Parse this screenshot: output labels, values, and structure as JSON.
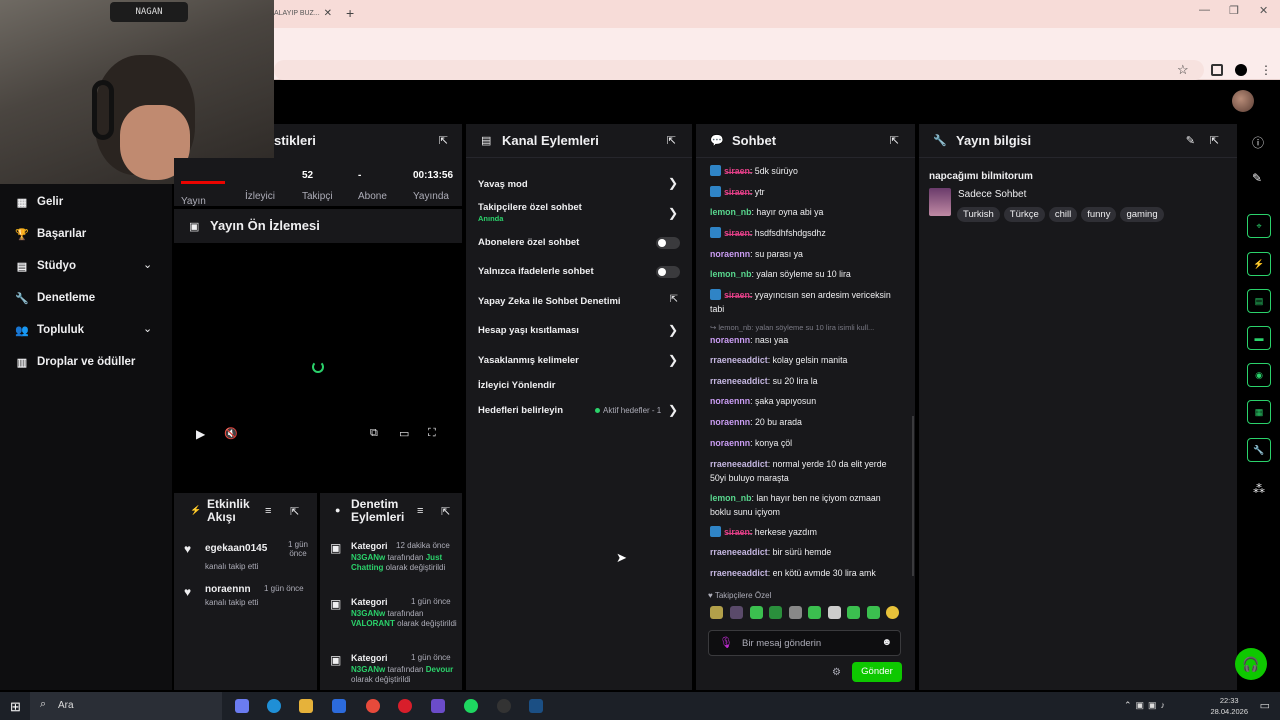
{
  "browser": {
    "tab_title": "ALAYIP BUZ...",
    "tab_close": "✕",
    "new_tab": "+",
    "window_controls": [
      "—",
      "❐",
      "✕"
    ]
  },
  "webcam": {
    "sign_text": "NAGAN"
  },
  "left_nav": {
    "items": [
      {
        "label": "Gelir",
        "icon": "grid-icon"
      },
      {
        "label": "Başarılar",
        "icon": "trophy-icon"
      },
      {
        "label": "Stüdyo",
        "icon": "studio-icon",
        "expand": true
      },
      {
        "label": "Denetleme",
        "icon": "wrench-icon"
      },
      {
        "label": "Topluluk",
        "icon": "community-icon",
        "expand": true
      },
      {
        "label": "Droplar ve ödüller",
        "icon": "drops-icon"
      }
    ]
  },
  "stats_panel": {
    "title": "stikleri",
    "stats": [
      {
        "value": "",
        "label": "Yayın"
      },
      {
        "value": "52",
        "label": "İzleyici"
      },
      {
        "value": "-",
        "label": "Takipçi"
      },
      {
        "value": "00:13:56",
        "label": "Abone"
      }
    ],
    "extra_label": "Yayında"
  },
  "preview": {
    "title": "Yayın Ön İzlemesi"
  },
  "activity": {
    "title": "Etkinlik Akışı",
    "items": [
      {
        "user": "egekaan0145",
        "action": "kanalı takip etti",
        "time": "1 gün önce"
      },
      {
        "user": "noraennn",
        "action": "kanalı takip etti",
        "time": "1 gün önce"
      }
    ]
  },
  "moderation": {
    "title": "Denetim Eylemleri",
    "items": [
      {
        "type": "Kategori",
        "time": "12 dakika önce",
        "by": "N3GANw",
        "middle": "tarafından",
        "value": "Just Chatting",
        "tail": "olarak değiştirildi"
      },
      {
        "type": "Kategori",
        "time": "1 gün önce",
        "by": "N3GANw",
        "middle": "tarafından",
        "value": "VALORANT",
        "tail": "olarak değiştirildi"
      },
      {
        "type": "Kategori",
        "time": "1 gün önce",
        "by": "N3GANw",
        "middle": "tarafından",
        "value": "Devour",
        "tail": "olarak değiştirildi"
      }
    ]
  },
  "channel_actions": {
    "title": "Kanal Eylemleri",
    "items": [
      {
        "label": "Yavaş mod",
        "control": "arrow"
      },
      {
        "label": "Takipçilere özel sohbet",
        "sub": "Anında",
        "control": "arrow"
      },
      {
        "label": "Abonelere özel sohbet",
        "control": "toggle"
      },
      {
        "label": "Yalnızca ifadelerle sohbet",
        "control": "toggle"
      },
      {
        "label": "Yapay Zeka ile Sohbet Denetimi",
        "control": "popout"
      },
      {
        "label": "Hesap yaşı kısıtlaması",
        "control": "arrow"
      },
      {
        "label": "Yasaklanmış kelimeler",
        "control": "arrow"
      },
      {
        "label": "İzleyici Yönlendir",
        "control": "none"
      },
      {
        "label": "Hedefleri belirleyin",
        "status": "Aktif hedefler - 1",
        "control": "arrow"
      }
    ]
  },
  "chat": {
    "title": "Sohbet",
    "messages": [
      {
        "user": "s̶i̶r̶a̶e̶n̶",
        "text": ": 5dk sürüyo",
        "badge": true,
        "cls": "u1"
      },
      {
        "user": "s̶i̶r̶a̶e̶n̶",
        "text": ": ytr",
        "badge": true,
        "cls": "u1"
      },
      {
        "user": "lemon_nb",
        "text": ": hayır oyna abi ya",
        "cls": "u2"
      },
      {
        "user": "s̶i̶r̶a̶e̶n̶",
        "text": ": hsdfsdhfshdgsdhz",
        "badge": true,
        "cls": "u1"
      },
      {
        "user": "noraennn",
        "text": ": su parası ya",
        "cls": "u3"
      },
      {
        "user": "lemon_nb",
        "text": ": yalan söyleme su 10 lira",
        "cls": "u2"
      },
      {
        "user": "s̶i̶r̶a̶e̶n̶",
        "text": ": yyayıncısın sen ardesim vericeksin tabi",
        "badge": true,
        "cls": "u1"
      },
      {
        "reply": "↪ lemon_nb: yalan söyleme su 10 lira isimli kull..."
      },
      {
        "user": "noraennn",
        "text": ": nası yaa",
        "cls": "u3"
      },
      {
        "user": "rraeneeaddict",
        "text": ": kolay gelsin manita",
        "cls": "u4"
      },
      {
        "user": "rraeneeaddict",
        "text": ": su 20 lira la",
        "cls": "u4"
      },
      {
        "user": "noraennn",
        "text": ": şaka yapıyosun",
        "cls": "u3"
      },
      {
        "user": "noraennn",
        "text": ": 20 bu arada",
        "cls": "u3"
      },
      {
        "user": "noraennn",
        "text": ": konya çöl",
        "cls": "u3"
      },
      {
        "user": "rraeneeaddict",
        "text": ": normal yerde 10 da elit yerde 50yi buluyo maraşta",
        "cls": "u4"
      },
      {
        "user": "lemon_nb",
        "text": ": lan hayır ben ne içiyom ozmaan boklu sunu içiyom",
        "cls": "u2"
      },
      {
        "user": "s̶i̶r̶a̶e̶n̶",
        "text": ": herkese yazdım",
        "badge": true,
        "cls": "u1"
      },
      {
        "user": "rraeneeaddict",
        "text": ": bir sürü hemde",
        "cls": "u4"
      },
      {
        "user": "rraeneeaddict",
        "text": ": en kötü avmde 30 lira amk",
        "cls": "u4"
      }
    ],
    "followers_only": "Takipçilere Özel",
    "input_placeholder": "Bir mesaj gönderin",
    "send_label": "Gönder"
  },
  "stream_info": {
    "title": "Yayın bilgisi",
    "stream_title": "napcağımı bilmitorum",
    "category": "Sadece Sohbet",
    "tags": [
      "Turkish",
      "Türkçe",
      "chill",
      "funny",
      "gaming"
    ]
  },
  "taskbar": {
    "search": "Ara",
    "time": "22:33",
    "date": "28.04.2026"
  },
  "colors": {
    "accent_green": "#2bd26b",
    "send_button": "#0ec800",
    "panel": "#18181b"
  }
}
